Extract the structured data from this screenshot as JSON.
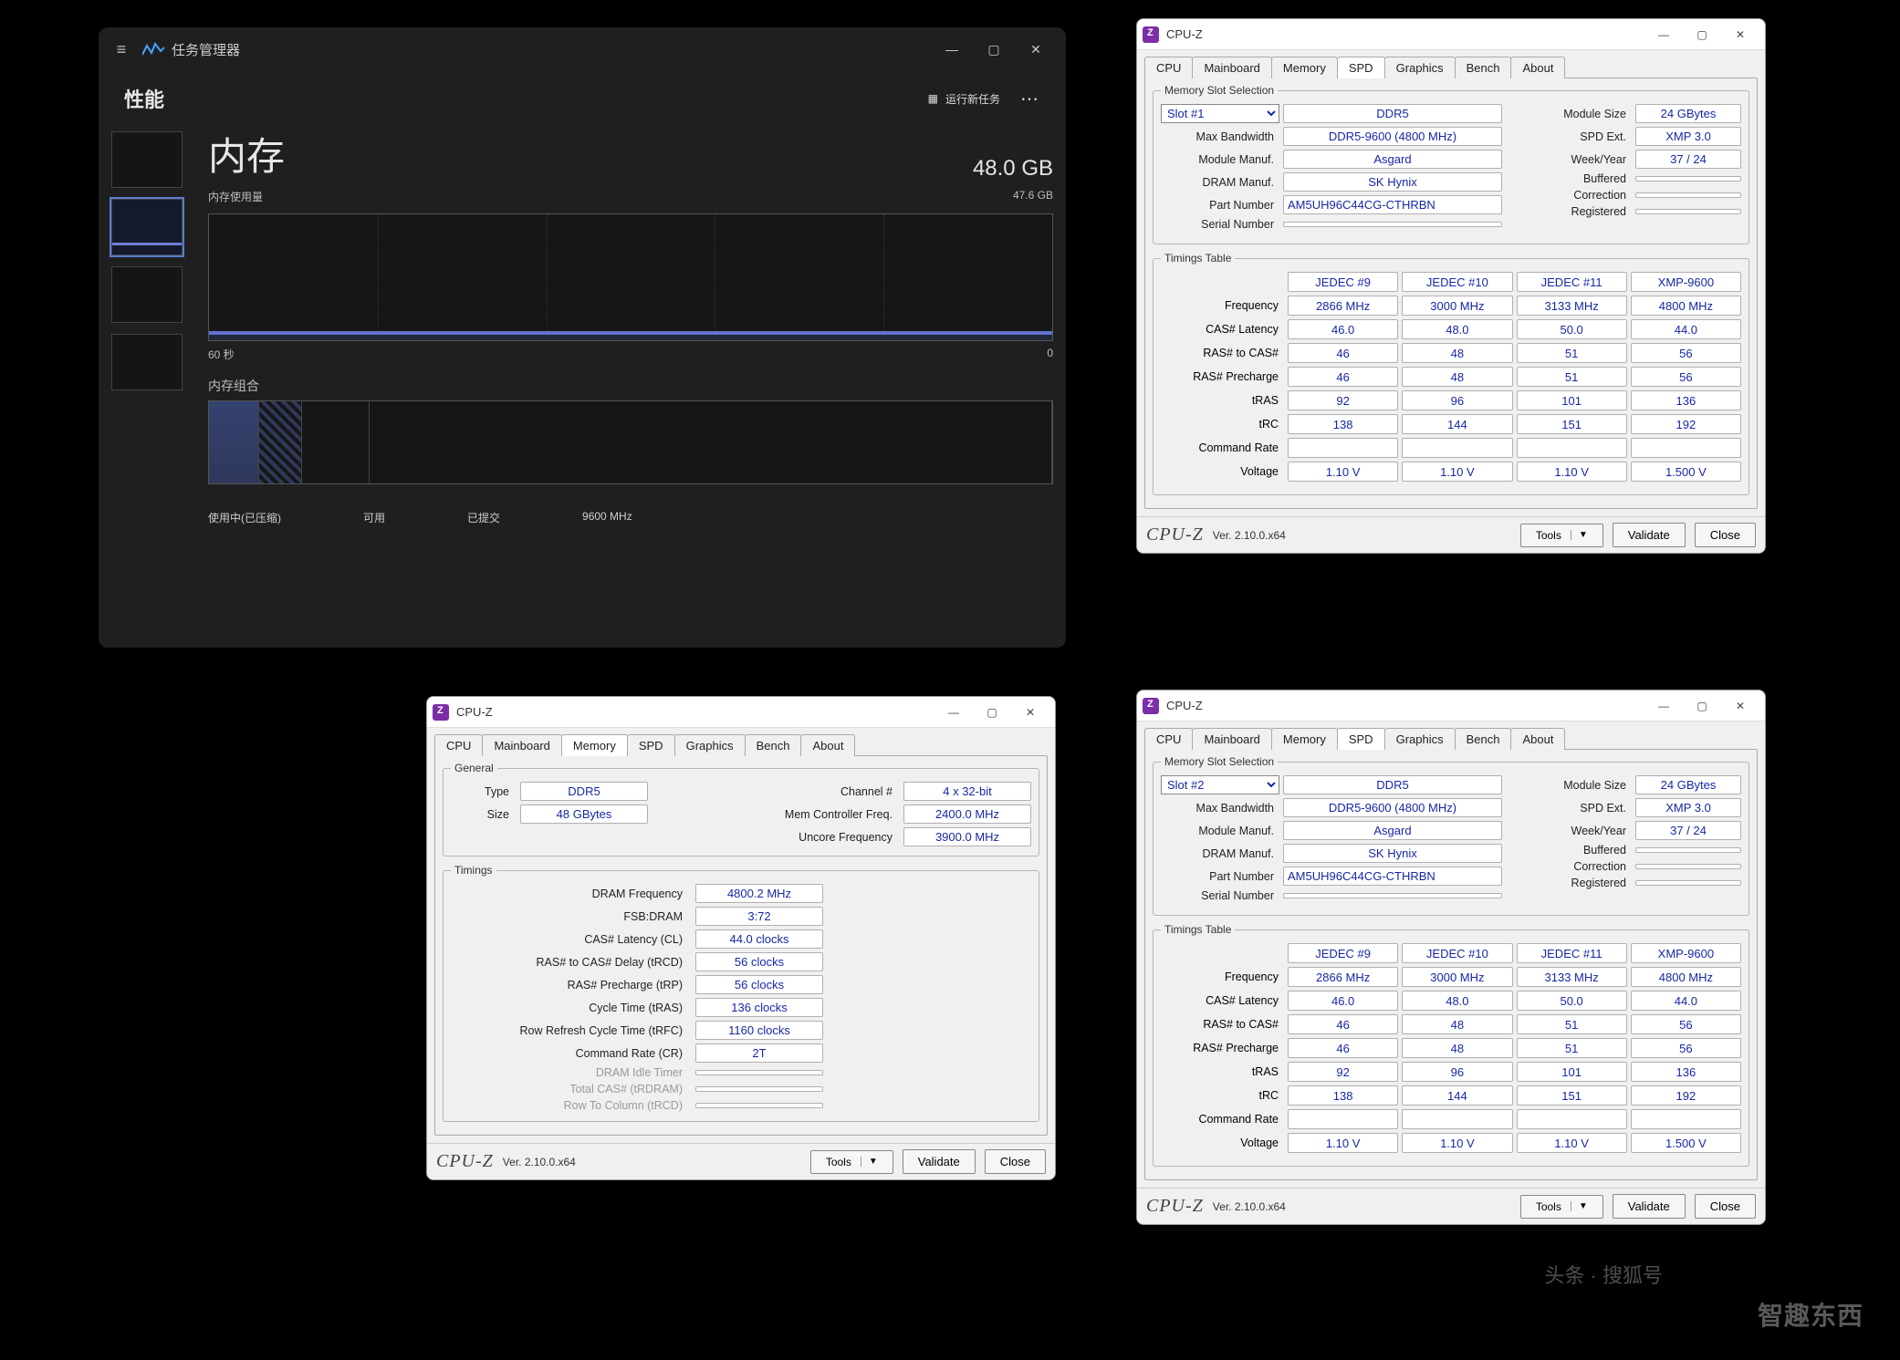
{
  "taskmgr": {
    "title": "任务管理器",
    "perf_tab": "性能",
    "new_task": "运行新任务",
    "heading": "内存",
    "total": "48.0 GB",
    "usage_label": "内存使用量",
    "usage_value": "47.6 GB",
    "axis_left": "60 秒",
    "axis_right": "0",
    "comp_label": "内存组合",
    "bottom_used": "使用中(已压缩)",
    "bottom_avail": "可用",
    "bottom_committed": "已提交",
    "bottom_speed": "9600 MHz"
  },
  "common": {
    "app_title": "CPU-Z",
    "brand": "CPU‑Z",
    "version": "Ver. 2.10.0.x64",
    "btn_tools": "Tools",
    "btn_validate": "Validate",
    "btn_close": "Close",
    "tabs": [
      "CPU",
      "Mainboard",
      "Memory",
      "SPD",
      "Graphics",
      "Bench",
      "About"
    ]
  },
  "spd": {
    "group_sel": "Memory Slot Selection",
    "group_tt": "Timings Table",
    "lbl_maxbw": "Max Bandwidth",
    "lbl_modmanuf": "Module Manuf.",
    "lbl_drammanuf": "DRAM Manuf.",
    "lbl_partnum": "Part Number",
    "lbl_serial": "Serial Number",
    "lbl_modsize": "Module Size",
    "lbl_spdext": "SPD Ext.",
    "lbl_weekyear": "Week/Year",
    "lbl_buffered": "Buffered",
    "lbl_correction": "Correction",
    "lbl_registered": "Registered",
    "common_vals": {
      "type": "DDR5",
      "maxbw": "DDR5-9600 (4800 MHz)",
      "modmanuf": "Asgard",
      "drammanuf": "SK Hynix",
      "partnum": "AM5UH96C44CG-CTHRBN",
      "modsize": "24 GBytes",
      "spdext": "XMP 3.0",
      "weekyear": "37 / 24"
    },
    "slot1_label": "Slot #1",
    "slot2_label": "Slot #2",
    "tt_cols": [
      "JEDEC #9",
      "JEDEC #10",
      "JEDEC #11",
      "XMP-9600"
    ],
    "tt_rows_labels": [
      "Frequency",
      "CAS# Latency",
      "RAS# to CAS#",
      "RAS# Precharge",
      "tRAS",
      "tRC",
      "Command Rate",
      "Voltage"
    ],
    "tt_rows": [
      [
        "2866 MHz",
        "3000 MHz",
        "3133 MHz",
        "4800 MHz"
      ],
      [
        "46.0",
        "48.0",
        "50.0",
        "44.0"
      ],
      [
        "46",
        "48",
        "51",
        "56"
      ],
      [
        "46",
        "48",
        "51",
        "56"
      ],
      [
        "92",
        "96",
        "101",
        "136"
      ],
      [
        "138",
        "144",
        "151",
        "192"
      ],
      [
        "",
        "",
        "",
        ""
      ],
      [
        "1.10 V",
        "1.10 V",
        "1.10 V",
        "1.500 V"
      ]
    ]
  },
  "mem": {
    "group_general": "General",
    "group_timings": "Timings",
    "lbl_type": "Type",
    "val_type": "DDR5",
    "lbl_size": "Size",
    "val_size": "48 GBytes",
    "lbl_channel": "Channel #",
    "val_channel": "4 x 32-bit",
    "lbl_mcfreq": "Mem Controller Freq.",
    "val_mcfreq": "2400.0 MHz",
    "lbl_uncore": "Uncore Frequency",
    "val_uncore": "3900.0 MHz",
    "lbl_dramfreq": "DRAM Frequency",
    "val_dramfreq": "4800.2 MHz",
    "lbl_fsbdram": "FSB:DRAM",
    "val_fsbdram": "3:72",
    "lbl_cl": "CAS# Latency (CL)",
    "val_cl": "44.0 clocks",
    "lbl_trcd": "RAS# to CAS# Delay (tRCD)",
    "val_trcd": "56 clocks",
    "lbl_trp": "RAS# Precharge (tRP)",
    "val_trp": "56 clocks",
    "lbl_tras": "Cycle Time (tRAS)",
    "val_tras": "136 clocks",
    "lbl_trfc": "Row Refresh Cycle Time (tRFC)",
    "val_trfc": "1160 clocks",
    "lbl_cr": "Command Rate (CR)",
    "val_cr": "2T",
    "lbl_idle": "DRAM Idle Timer",
    "lbl_trdram": "Total CAS# (tRDRAM)",
    "lbl_trcd2": "Row To Column (tRCD)"
  },
  "watermark": "智趣东西",
  "watermark_src": "头条 · 搜狐号"
}
